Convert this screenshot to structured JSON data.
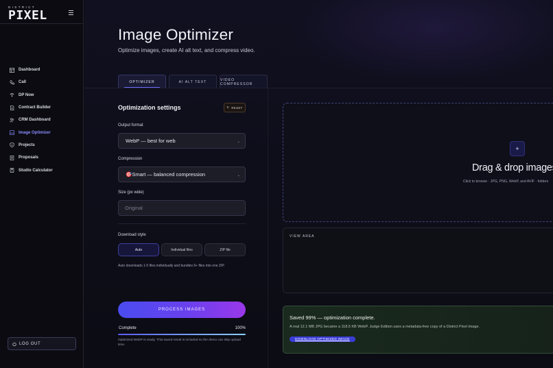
{
  "brand": {
    "top": "DISTRICT",
    "main": "PIXEL"
  },
  "sidebar": {
    "items": [
      {
        "label": "Dashboard",
        "icon": "dashboard-icon"
      },
      {
        "label": "Call",
        "icon": "phone-icon"
      },
      {
        "label": "DP Now",
        "icon": "wifi-icon"
      },
      {
        "label": "Contract Builder",
        "icon": "document-icon"
      },
      {
        "label": "CRM Dashboard",
        "icon": "users-icon"
      },
      {
        "label": "Image Optimizer",
        "icon": "image-icon",
        "active": true
      },
      {
        "label": "Projects",
        "icon": "shield-icon"
      },
      {
        "label": "Proposals",
        "icon": "document-icon"
      },
      {
        "label": "Studio Calculator",
        "icon": "calculator-icon"
      }
    ],
    "logout_label": "LOG OUT"
  },
  "header": {
    "title": "Image Optimizer",
    "subtitle": "Optimize images, create AI alt text, and compress video."
  },
  "tabs": [
    {
      "label": "OPTIMIZER",
      "active": true
    },
    {
      "label": "AI ALT TEXT"
    },
    {
      "label": "VIDEO COMPRESSOR"
    }
  ],
  "settings": {
    "title": "Optimization settings",
    "reset_label": "RESET",
    "output_format": {
      "label": "Output format",
      "value": "WebP — best for web"
    },
    "compression": {
      "label": "Compression",
      "value": "🎯Smart — balanced compression"
    },
    "size": {
      "label": "Size (px wide)",
      "placeholder": "Original"
    },
    "download_style": {
      "label": "Download style",
      "options": [
        "Auto",
        "Individual files",
        "ZIP file"
      ],
      "selected": "Auto",
      "hint": "Auto downloads 1-5 files individually and bundles 6+ files into one ZIP."
    },
    "process_label": "PROCESS IMAGES",
    "progress": {
      "label": "Complete",
      "percent_text": "100%",
      "value": 1.0,
      "note": "Optimized WebP is ready. This saved result is included so the demo can skip upload time."
    }
  },
  "dropzone": {
    "title": "Drag & drop images he",
    "hint": "Click to browse · JPG, PNG, WebP, and AVIF · folders"
  },
  "viewarea": {
    "label": "VIEW AREA"
  },
  "result": {
    "title": "Saved 99% — optimization complete.",
    "text": "A real 12.1 MB JPG became a 118.5 KB WebP. Judge Edition uses a metadata-free copy of a District Pixel image.",
    "link_label": "DOWNLOAD OPTIMIZED IMAGE"
  },
  "colors": {
    "accent": "#6c6cff",
    "active_nav": "#8c8cff",
    "success_bg": "#1a2a1e"
  }
}
